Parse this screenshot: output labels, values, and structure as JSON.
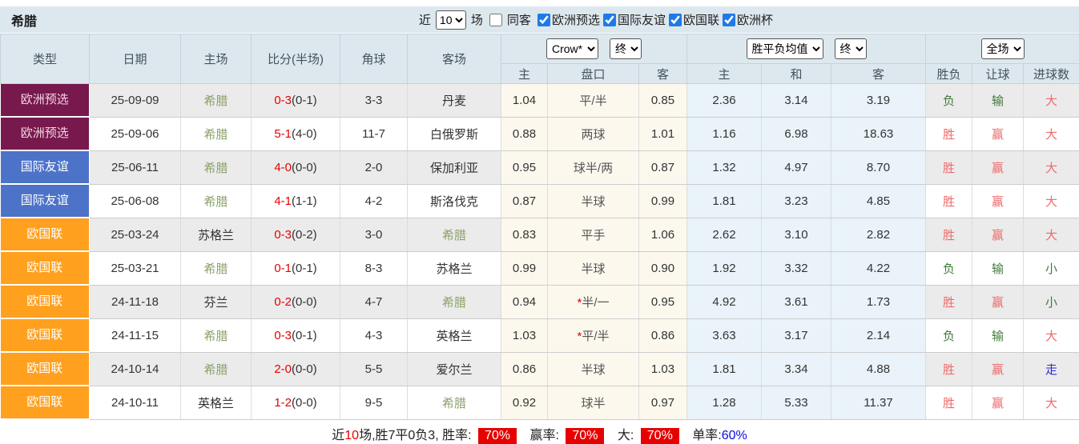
{
  "colors": {
    "header_bg": "#dde7ee",
    "row_alt_bg": "#ebebeb",
    "handicap_col_bg": "#fcf8ee",
    "avg_col_bg": "#e9f3f9",
    "badge_euro_qualifier": "#77194d",
    "badge_friendly": "#4d73c9",
    "badge_nations_league": "#ffa01e",
    "score_red": "#e60000",
    "result_red": "#ef6a6a",
    "result_green": "#41793b",
    "result_blue": "#2b2bdb",
    "team_self_green": "#8ba168",
    "rate_badge_bg": "#e60000",
    "single_rate_blue": "#0b0be6"
  },
  "title_bar": {
    "team": "希腊",
    "recent_label": "近",
    "recent_value": "10",
    "matches_label": "场",
    "same_venue_label": "同客",
    "filters": [
      {
        "label": "欧洲预选",
        "checked_attr": "checked"
      },
      {
        "label": "国际友谊",
        "checked_attr": "checked"
      },
      {
        "label": "欧国联",
        "checked_attr": "checked"
      },
      {
        "label": "欧洲杯",
        "checked_attr": "checked"
      }
    ]
  },
  "header": {
    "type": "类型",
    "date": "日期",
    "home": "主场",
    "score": "比分(半场)",
    "corner": "角球",
    "away": "客场",
    "odds_source": "Crow*",
    "odds_time": "终",
    "odds_home": "主",
    "odds_handicap": "盘口",
    "odds_away": "客",
    "avg_source": "胜平负均值",
    "avg_time": "终",
    "avg_home": "主",
    "avg_draw": "和",
    "avg_away": "客",
    "scope": "全场",
    "res_wdl": "胜负",
    "res_handicap": "让球",
    "res_goals": "进球数"
  },
  "rows": [
    {
      "type": "欧洲预选",
      "type_cls": "b-maroon",
      "date": "25-09-09",
      "home": "希腊",
      "home_cls": "self",
      "score_ft": "0-3",
      "score_ht": "(0-1)",
      "corner": "3-3",
      "away": "丹麦",
      "away_cls": "",
      "o_home": "1.04",
      "hcp_star": "",
      "hcp": "平/半",
      "o_away": "0.85",
      "a_home": "2.36",
      "a_draw": "3.14",
      "a_away": "3.19",
      "wdl": "负",
      "wdl_cls": "neg",
      "cover": "输",
      "cover_cls": "neg",
      "goals": "大",
      "goals_cls": "pos"
    },
    {
      "type": "欧洲预选",
      "type_cls": "b-maroon",
      "date": "25-09-06",
      "home": "希腊",
      "home_cls": "self",
      "score_ft": "5-1",
      "score_ht": "(4-0)",
      "corner": "11-7",
      "away": "白俄罗斯",
      "away_cls": "",
      "o_home": "0.88",
      "hcp_star": "",
      "hcp": "两球",
      "o_away": "1.01",
      "a_home": "1.16",
      "a_draw": "6.98",
      "a_away": "18.63",
      "wdl": "胜",
      "wdl_cls": "pos",
      "cover": "赢",
      "cover_cls": "pos",
      "goals": "大",
      "goals_cls": "pos"
    },
    {
      "type": "国际友谊",
      "type_cls": "b-blue",
      "date": "25-06-11",
      "home": "希腊",
      "home_cls": "self",
      "score_ft": "4-0",
      "score_ht": "(0-0)",
      "corner": "2-0",
      "away": "保加利亚",
      "away_cls": "",
      "o_home": "0.95",
      "hcp_star": "",
      "hcp": "球半/两",
      "o_away": "0.87",
      "a_home": "1.32",
      "a_draw": "4.97",
      "a_away": "8.70",
      "wdl": "胜",
      "wdl_cls": "pos",
      "cover": "赢",
      "cover_cls": "pos",
      "goals": "大",
      "goals_cls": "pos"
    },
    {
      "type": "国际友谊",
      "type_cls": "b-blue",
      "date": "25-06-08",
      "home": "希腊",
      "home_cls": "self",
      "score_ft": "4-1",
      "score_ht": "(1-1)",
      "corner": "4-2",
      "away": "斯洛伐克",
      "away_cls": "",
      "o_home": "0.87",
      "hcp_star": "",
      "hcp": "半球",
      "o_away": "0.99",
      "a_home": "1.81",
      "a_draw": "3.23",
      "a_away": "4.85",
      "wdl": "胜",
      "wdl_cls": "pos",
      "cover": "赢",
      "cover_cls": "pos",
      "goals": "大",
      "goals_cls": "pos"
    },
    {
      "type": "欧国联",
      "type_cls": "b-orange",
      "date": "25-03-24",
      "home": "苏格兰",
      "home_cls": "",
      "score_ft": "0-3",
      "score_ht": "(0-2)",
      "corner": "3-0",
      "away": "希腊",
      "away_cls": "self",
      "o_home": "0.83",
      "hcp_star": "",
      "hcp": "平手",
      "o_away": "1.06",
      "a_home": "2.62",
      "a_draw": "3.10",
      "a_away": "2.82",
      "wdl": "胜",
      "wdl_cls": "pos",
      "cover": "赢",
      "cover_cls": "pos",
      "goals": "大",
      "goals_cls": "pos"
    },
    {
      "type": "欧国联",
      "type_cls": "b-orange",
      "date": "25-03-21",
      "home": "希腊",
      "home_cls": "self",
      "score_ft": "0-1",
      "score_ht": "(0-1)",
      "corner": "8-3",
      "away": "苏格兰",
      "away_cls": "",
      "o_home": "0.99",
      "hcp_star": "",
      "hcp": "半球",
      "o_away": "0.90",
      "a_home": "1.92",
      "a_draw": "3.32",
      "a_away": "4.22",
      "wdl": "负",
      "wdl_cls": "neg",
      "cover": "输",
      "cover_cls": "neg",
      "goals": "小",
      "goals_cls": "neg"
    },
    {
      "type": "欧国联",
      "type_cls": "b-orange",
      "date": "24-11-18",
      "home": "芬兰",
      "home_cls": "",
      "score_ft": "0-2",
      "score_ht": "(0-0)",
      "corner": "4-7",
      "away": "希腊",
      "away_cls": "self",
      "o_home": "0.94",
      "hcp_star": "*",
      "hcp": "半/一",
      "o_away": "0.95",
      "a_home": "4.92",
      "a_draw": "3.61",
      "a_away": "1.73",
      "wdl": "胜",
      "wdl_cls": "pos",
      "cover": "赢",
      "cover_cls": "pos",
      "goals": "小",
      "goals_cls": "neg"
    },
    {
      "type": "欧国联",
      "type_cls": "b-orange",
      "date": "24-11-15",
      "home": "希腊",
      "home_cls": "self",
      "score_ft": "0-3",
      "score_ht": "(0-1)",
      "corner": "4-3",
      "away": "英格兰",
      "away_cls": "",
      "o_home": "1.03",
      "hcp_star": "*",
      "hcp": "平/半",
      "o_away": "0.86",
      "a_home": "3.63",
      "a_draw": "3.17",
      "a_away": "2.14",
      "wdl": "负",
      "wdl_cls": "neg",
      "cover": "输",
      "cover_cls": "neg",
      "goals": "大",
      "goals_cls": "pos"
    },
    {
      "type": "欧国联",
      "type_cls": "b-orange",
      "date": "24-10-14",
      "home": "希腊",
      "home_cls": "self",
      "score_ft": "2-0",
      "score_ht": "(0-0)",
      "corner": "5-5",
      "away": "爱尔兰",
      "away_cls": "",
      "o_home": "0.86",
      "hcp_star": "",
      "hcp": "半球",
      "o_away": "1.03",
      "a_home": "1.81",
      "a_draw": "3.34",
      "a_away": "4.88",
      "wdl": "胜",
      "wdl_cls": "pos",
      "cover": "赢",
      "cover_cls": "pos",
      "goals": "走",
      "goals_cls": "push"
    },
    {
      "type": "欧国联",
      "type_cls": "b-orange",
      "date": "24-10-11",
      "home": "英格兰",
      "home_cls": "",
      "score_ft": "1-2",
      "score_ht": "(0-0)",
      "corner": "9-5",
      "away": "希腊",
      "away_cls": "self",
      "o_home": "0.92",
      "hcp_star": "",
      "hcp": "球半",
      "o_away": "0.97",
      "a_home": "1.28",
      "a_draw": "5.33",
      "a_away": "11.37",
      "wdl": "胜",
      "wdl_cls": "pos",
      "cover": "赢",
      "cover_cls": "pos",
      "goals": "大",
      "goals_cls": "pos"
    }
  ],
  "footer": {
    "prefix": "近",
    "recent_count": "10",
    "record_text": "场,胜7平0负3, 胜率:",
    "win_rate": "70%",
    "cover_label": "赢率:",
    "cover_rate": "70%",
    "big_label": "大:",
    "big_rate": "70%",
    "single_label": "单率:",
    "single_rate": "60%"
  }
}
